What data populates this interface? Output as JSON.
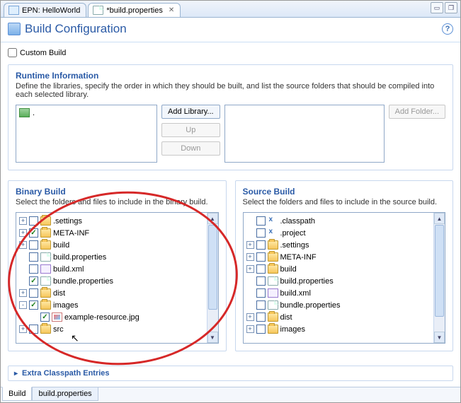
{
  "tabs": {
    "editor": [
      {
        "label": "EPN: HelloWorld",
        "active": false,
        "icon": "diagram-icon"
      },
      {
        "label": "*build.properties",
        "active": true,
        "icon": "properties-file-icon"
      }
    ],
    "bottom": [
      {
        "label": "Build",
        "active": true
      },
      {
        "label": "build.properties",
        "active": false
      }
    ]
  },
  "page": {
    "title": "Build Configuration",
    "custom_build_label": "Custom Build",
    "custom_build_checked": false
  },
  "runtime": {
    "title": "Runtime Information",
    "desc": "Define the libraries, specify the order in which they should be built, and list the source folders that should be compiled into each selected library.",
    "libraries": [
      {
        "label": "."
      }
    ],
    "buttons": {
      "add_library": "Add Library...",
      "up": "Up",
      "down": "Down",
      "add_folder": "Add Folder..."
    }
  },
  "binary": {
    "title": "Binary Build",
    "desc": "Select the folders and files to include in the binary build.",
    "items": [
      {
        "exp": "+",
        "checked": false,
        "type": "folder",
        "label": ".settings"
      },
      {
        "exp": "+",
        "checked": true,
        "type": "folder",
        "label": "META-INF"
      },
      {
        "exp": "+",
        "checked": false,
        "type": "folder",
        "label": "build"
      },
      {
        "exp": "",
        "checked": false,
        "type": "file",
        "label": "build.properties"
      },
      {
        "exp": "",
        "checked": false,
        "type": "xml",
        "label": "build.xml"
      },
      {
        "exp": "",
        "checked": true,
        "type": "file",
        "label": "bundle.properties"
      },
      {
        "exp": "+",
        "checked": false,
        "type": "folder",
        "label": "dist"
      },
      {
        "exp": "-",
        "checked": true,
        "type": "folder",
        "label": "images"
      },
      {
        "exp": "",
        "checked": true,
        "type": "img",
        "label": "example-resource.jpg",
        "indent": 1
      },
      {
        "exp": "+",
        "checked": false,
        "type": "folder",
        "label": "src"
      }
    ]
  },
  "source": {
    "title": "Source Build",
    "desc": "Select the folders and files to include in the source build.",
    "items": [
      {
        "exp": "",
        "checked": false,
        "type": "x",
        "label": ".classpath"
      },
      {
        "exp": "",
        "checked": false,
        "type": "x",
        "label": ".project"
      },
      {
        "exp": "+",
        "checked": false,
        "type": "folder",
        "label": ".settings"
      },
      {
        "exp": "+",
        "checked": false,
        "type": "folder",
        "label": "META-INF"
      },
      {
        "exp": "+",
        "checked": false,
        "type": "folder",
        "label": "build"
      },
      {
        "exp": "",
        "checked": false,
        "type": "file",
        "label": "build.properties"
      },
      {
        "exp": "",
        "checked": false,
        "type": "xml",
        "label": "build.xml"
      },
      {
        "exp": "",
        "checked": false,
        "type": "file",
        "label": "bundle.properties"
      },
      {
        "exp": "+",
        "checked": false,
        "type": "folder",
        "label": "dist"
      },
      {
        "exp": "+",
        "checked": false,
        "type": "folder",
        "label": "images"
      }
    ]
  },
  "extra": {
    "label": "Extra Classpath Entries"
  }
}
